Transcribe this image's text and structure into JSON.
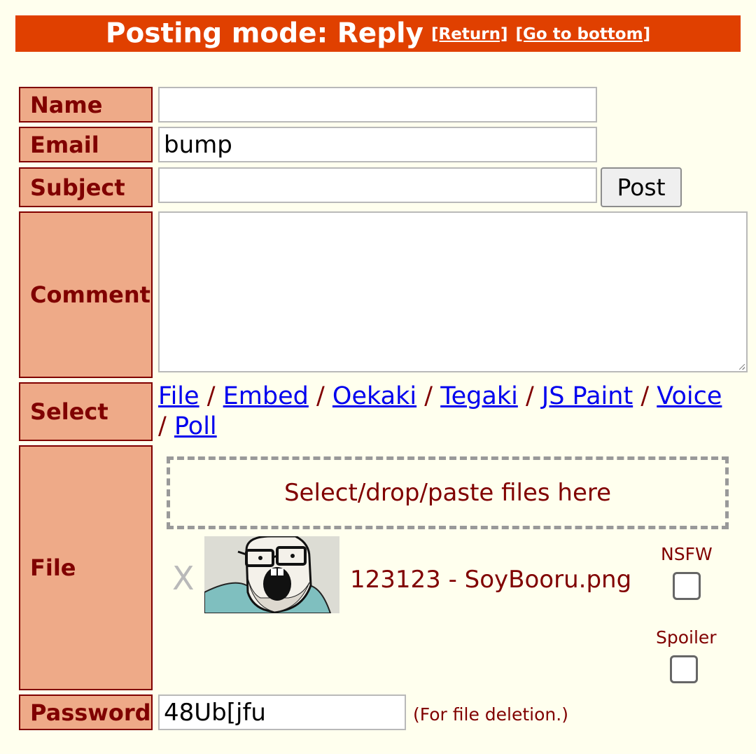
{
  "banner": {
    "title": "Posting mode: Reply",
    "return_link": "[Return]",
    "bottom_link": "[Go to bottom]"
  },
  "form": {
    "name": {
      "label": "Name",
      "value": ""
    },
    "email": {
      "label": "Email",
      "value": "bump"
    },
    "subject": {
      "label": "Subject",
      "value": ""
    },
    "post_button": "Post",
    "comment": {
      "label": "Comment",
      "value": ""
    },
    "select": {
      "label": "Select",
      "separator": "/",
      "options": [
        "File",
        "Embed",
        "Oekaki",
        "Tegaki",
        "JS Paint",
        "Voice",
        "Poll"
      ]
    },
    "file": {
      "label": "File",
      "dropzone_text": "Select/drop/paste files here",
      "remove_glyph": "X",
      "filename": "123123 - SoyBooru.png",
      "nsfw_label": "NSFW",
      "spoiler_label": "Spoiler",
      "nsfw_checked": false,
      "spoiler_checked": false
    },
    "password": {
      "label": "Password",
      "value": "48Ub[jfu",
      "note": "(For file deletion.)"
    }
  },
  "colors": {
    "page_background": "#ffffee",
    "banner_background": "#e04000",
    "label_background": "#eeaa88",
    "label_text": "#800000",
    "link": "#0000ee"
  }
}
